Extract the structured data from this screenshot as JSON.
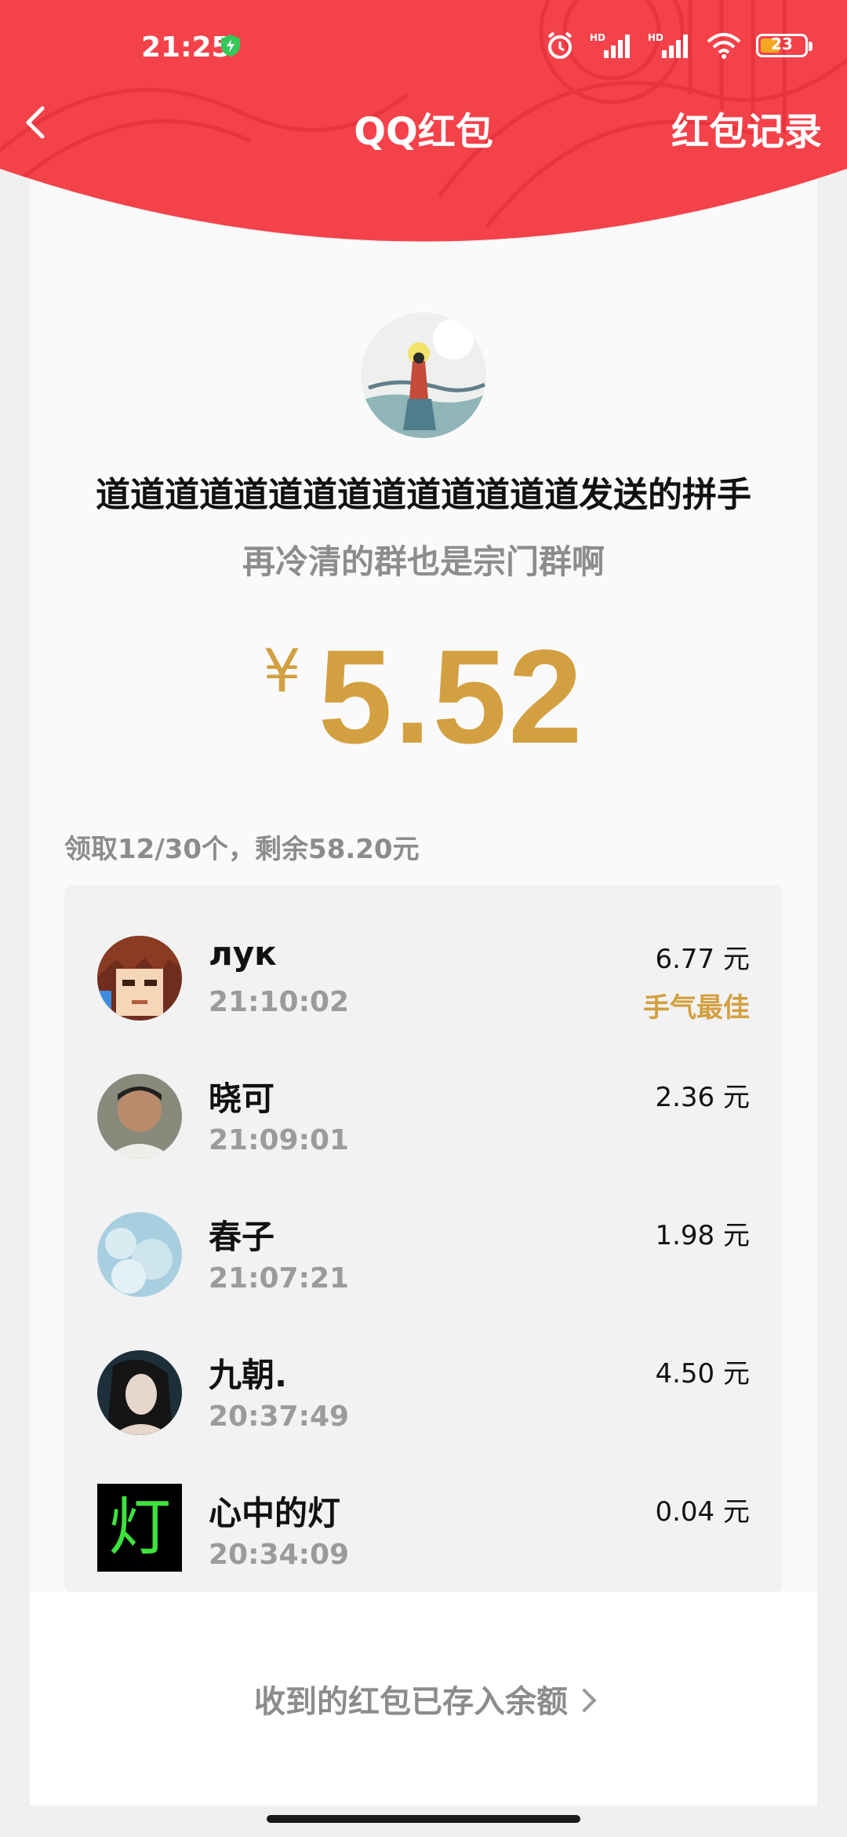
{
  "status": {
    "time": "21:25",
    "battery": "23"
  },
  "nav": {
    "title": "QQ红包",
    "record_label": "红包记录"
  },
  "sender": {
    "line": "道道道道道道道道道道道道道道发送的拼手",
    "wish": "再冷清的群也是宗门群啊"
  },
  "amount": {
    "currency": "¥",
    "value": "5.52"
  },
  "summary": "领取12/30个，剩余58.20元",
  "receivers": [
    {
      "name": "лук",
      "time": "21:10:02",
      "amount": "6.77 元",
      "badge": "手气最佳"
    },
    {
      "name": "晓可",
      "time": "21:09:01",
      "amount": "2.36 元"
    },
    {
      "name": "春子",
      "time": "21:07:21",
      "amount": "1.98 元"
    },
    {
      "name": "九朝.",
      "time": "20:37:49",
      "amount": "4.50 元"
    },
    {
      "name": "心中的灯",
      "time": "20:34:09",
      "amount": "0.04 元",
      "avatar_char": "灯"
    }
  ],
  "footer": {
    "balance_link": "收到的红包已存入余额"
  },
  "colors": {
    "header_red": "#f4424a",
    "gold": "#d2a040"
  }
}
